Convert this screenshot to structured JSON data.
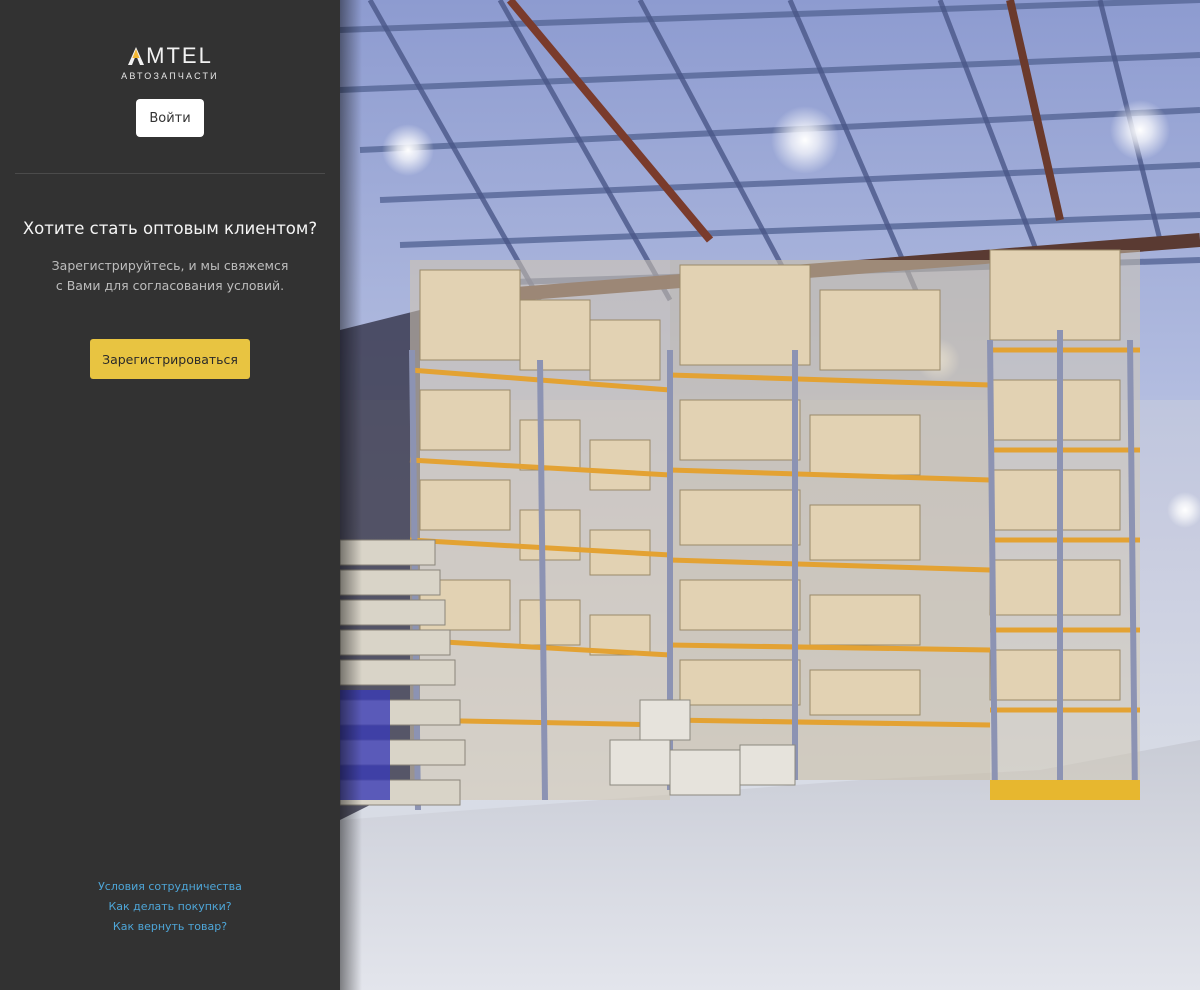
{
  "brand": {
    "name": "MTEL",
    "tagline": "АВТОЗАПЧАСТИ",
    "accent": "#f2b632"
  },
  "sidebar": {
    "login_label": "Войти",
    "promo_title": "Хотите стать оптовым клиентом?",
    "promo_line1": "Зарегистрируйтесь, и мы свяжемся",
    "promo_line2": "с Вами для согласования условий.",
    "register_label": "Зарегистрироваться",
    "register_color": "#e8c441",
    "links": [
      {
        "label": "Условия сотрудничества"
      },
      {
        "label": "Как делать покупки?"
      },
      {
        "label": "Как вернуть товар?"
      }
    ],
    "link_color": "#4ea6d8"
  },
  "hero": {
    "icon": "warehouse-photo"
  }
}
